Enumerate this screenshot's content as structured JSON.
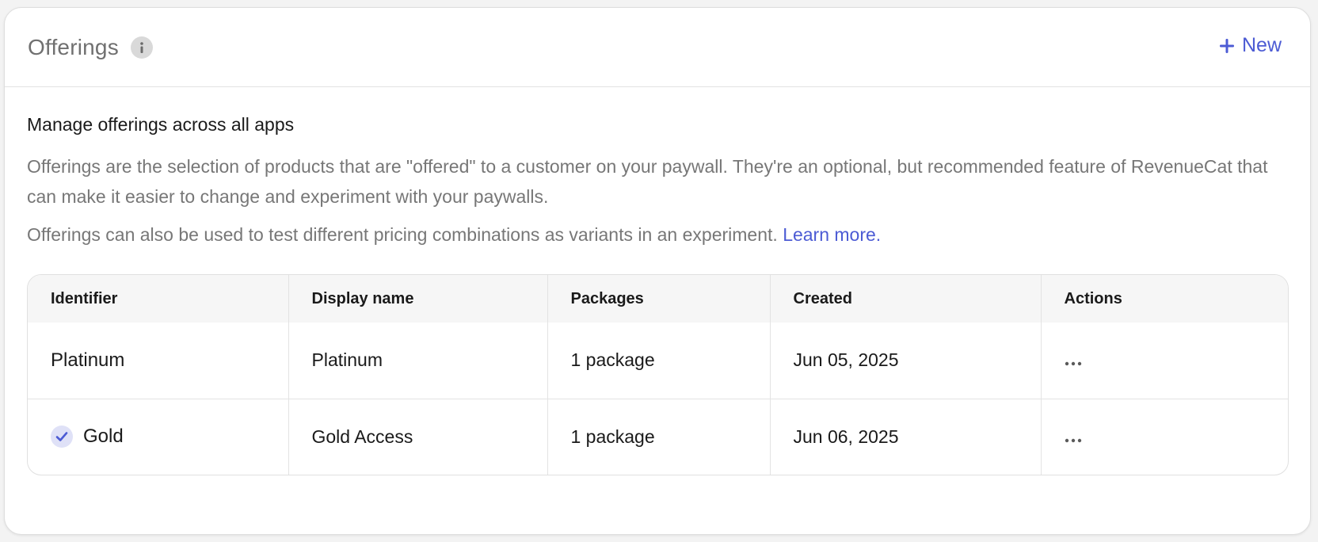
{
  "header": {
    "title": "Offerings",
    "new_label": "New"
  },
  "body": {
    "subtitle": "Manage offerings across all apps",
    "description": "Offerings are the selection of products that are \"offered\" to a customer on your paywall. They're an optional, but recommended feature of RevenueCat that can make it easier to change and experiment with your paywalls.",
    "description2": "Offerings can also be used to test different pricing combinations as variants in an experiment.",
    "learn_more": "Learn more."
  },
  "table": {
    "columns": [
      "Identifier",
      "Display name",
      "Packages",
      "Created",
      "Actions"
    ],
    "rows": [
      {
        "identifier": "Platinum",
        "display_name": "Platinum",
        "packages": "1 package",
        "created": "Jun 05, 2025",
        "current": false
      },
      {
        "identifier": "Gold",
        "display_name": "Gold Access",
        "packages": "1 package",
        "created": "Jun 06, 2025",
        "current": true
      }
    ]
  },
  "icons": {
    "info": "info-icon",
    "plus": "plus-icon",
    "check": "check-icon",
    "more": "more-horizontal-icon"
  },
  "colors": {
    "accent": "#4c5bd4",
    "muted_text": "#777777",
    "check_bg": "#dfe1f7"
  }
}
